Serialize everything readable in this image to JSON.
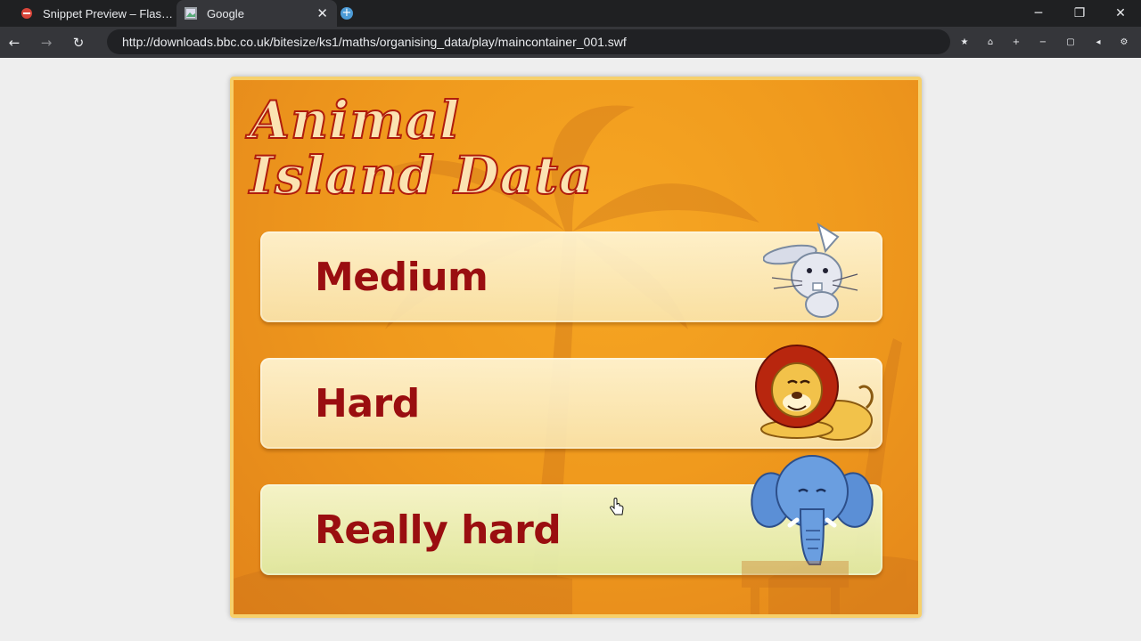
{
  "browser": {
    "tabs": [
      {
        "title": "Snippet Preview – Flash ...",
        "icon": "flash-puzzle-icon"
      },
      {
        "title": "Google",
        "icon": "page-icon",
        "close": "✕"
      }
    ],
    "new_tab_icon": "+",
    "window_controls": {
      "minimize": "─",
      "restore": "❐",
      "close": "✕"
    },
    "nav": {
      "back": "←",
      "forward": "→",
      "reload": "↻"
    },
    "url": "http://downloads.bbc.co.uk/bitesize/ks1/maths/organising_data/play/maincontainer_001.swf",
    "toolbar_icons": [
      "star-icon",
      "home-icon",
      "zoom-in-icon",
      "zoom-out-icon",
      "fullscreen-icon",
      "volume-icon",
      "settings-icon"
    ]
  },
  "game": {
    "title_line1": "Animal",
    "title_line2": "Island Data",
    "levels": [
      {
        "label": "Medium",
        "animal": "rabbit"
      },
      {
        "label": "Hard",
        "animal": "lion"
      },
      {
        "label": "Really hard",
        "animal": "elephant"
      }
    ]
  },
  "colors": {
    "stage_orange": "#f09a1d",
    "label_red": "#9a0e10",
    "title_outline": "#b01c0c",
    "chrome_dark": "#35363a"
  }
}
